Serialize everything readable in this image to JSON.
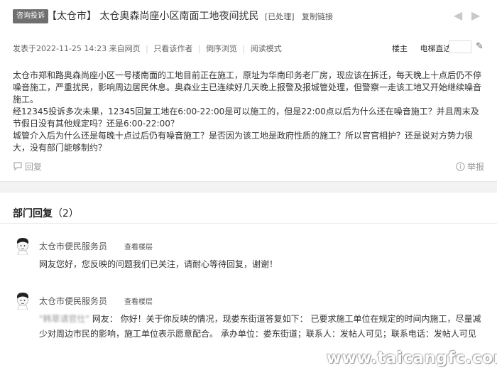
{
  "header": {
    "badge": "咨询投诉",
    "title": "【太仓市】 太仓奥森尚座小区南面工地夜间扰民",
    "status": "[已处理]",
    "copy_link": "复制链接",
    "prev_arrow": "◀",
    "next_arrow": "▶"
  },
  "meta": {
    "posted": "发表于2022-11-25 14:23",
    "source": "来自网页",
    "only_author": "只看该作者",
    "reverse": "倒序浏览",
    "reading_mode": "阅读模式",
    "op": "楼主",
    "elevator": "电梯直达"
  },
  "post": {
    "paragraphs": [
      "太仓市郑和路奥森尚座小区一号楼南面的工地目前正在施工，原址为华南印务老厂房，现应该在拆迁，每天晚上十点后仍不停噪音施工，严重扰民，影响周边居民休息。奥森业主已连续好几天晚上报警及报城管处理，但警察一走该工地又开始继续噪音施工。",
      "经12345投诉多次未果，12345回复工地在6:00-22:00是可以施工的，但是22:00点以后为什么还在噪音施工？并且周末及节假日没有其他规定吗？还是6:00-22:00？",
      "城管介入后为什么还是每晚十点过后仍有噪音施工？是否因为该工地是政府性质的施工？所以官官相护？还是说对方势力很大，没有部门能够制约？"
    ],
    "reply_label": "回复",
    "report_label": "举报"
  },
  "replies_section": {
    "title": "部门回复",
    "count": "（2）",
    "items": [
      {
        "author": "太仓市便民服务员",
        "view_floor": "查看楼层",
        "text": "网友您好，您反映的问题我们已关注，请耐心等待回复，谢谢！"
      },
      {
        "author": "太仓市便民服务员",
        "view_floor": "查看楼层",
        "quoted_user": "\"韩草请官仕\"",
        "text": " 网友： 你好！关于你反映的情况，现娄东街道答复如下： 已要求施工单位在规定的时间内施工，尽量减少对周边市民的影响，施工单位表示愿意配合。 承办单位：娄东街道；联系人：发帖人可见；联系电话：发帖人可见"
      }
    ]
  },
  "watermark": "www.taicangfc.com"
}
